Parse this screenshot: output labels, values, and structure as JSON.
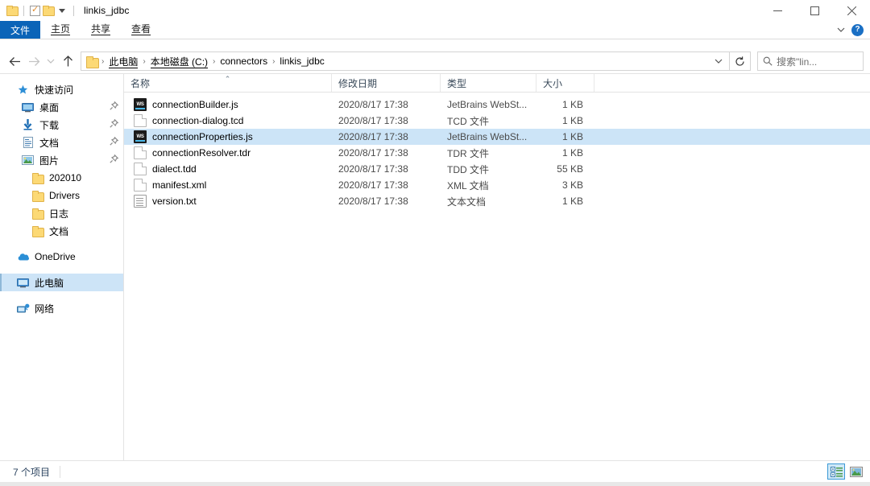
{
  "window": {
    "title": "linkis_jdbc",
    "quick_access": [
      {
        "name": "folder-icon",
        "label": "文件夹"
      },
      {
        "name": "properties-icon",
        "label": "属性"
      },
      {
        "name": "new-folder-icon",
        "label": "新建文件夹"
      },
      {
        "name": "customize-caret-icon",
        "label": "自定义快速访问工具栏"
      }
    ],
    "controls": {
      "minimize": "最小化",
      "maximize": "最大化",
      "close": "关闭"
    }
  },
  "ribbon": {
    "tabs": [
      {
        "label": "文件",
        "active": true
      },
      {
        "label": "主页",
        "active": false
      },
      {
        "label": "共享",
        "active": false
      },
      {
        "label": "查看",
        "active": false
      }
    ],
    "collapse_label": "折叠功能区",
    "help_label": "?"
  },
  "nav": {
    "back": "后退",
    "forward": "前进",
    "recent": "最近浏览的位置",
    "up": "上移一级",
    "dropdown": "以前的位置",
    "refresh": "刷新"
  },
  "breadcrumb": {
    "items": [
      "此电脑",
      "本地磁盘 (C:)",
      "connectors",
      "linkis_jdbc"
    ],
    "separator": "›"
  },
  "search": {
    "placeholder": "搜索\"lin...",
    "icon": "search-icon"
  },
  "sidebar": {
    "items": [
      {
        "label": "快速访问",
        "icon": "star-icon",
        "level": 0,
        "pinned": false,
        "selected": false
      },
      {
        "label": "桌面",
        "icon": "desktop-icon",
        "level": 1,
        "pinned": true,
        "selected": false
      },
      {
        "label": "下载",
        "icon": "download-icon",
        "level": 1,
        "pinned": true,
        "selected": false
      },
      {
        "label": "文档",
        "icon": "documents-icon",
        "level": 1,
        "pinned": true,
        "selected": false
      },
      {
        "label": "图片",
        "icon": "pictures-icon",
        "level": 1,
        "pinned": true,
        "selected": false
      },
      {
        "label": "202010",
        "icon": "folder-icon",
        "level": 2,
        "pinned": false,
        "selected": false
      },
      {
        "label": "Drivers",
        "icon": "folder-icon",
        "level": 2,
        "pinned": false,
        "selected": false
      },
      {
        "label": "日志",
        "icon": "folder-icon",
        "level": 2,
        "pinned": false,
        "selected": false
      },
      {
        "label": "文档",
        "icon": "folder-icon",
        "level": 2,
        "pinned": false,
        "selected": false
      },
      {
        "label": "OneDrive",
        "icon": "cloud-icon",
        "level": 0,
        "pinned": false,
        "selected": false
      },
      {
        "label": "此电脑",
        "icon": "computer-icon",
        "level": 0,
        "pinned": false,
        "selected": true
      },
      {
        "label": "网络",
        "icon": "network-icon",
        "level": 0,
        "pinned": false,
        "selected": false
      }
    ]
  },
  "filelist": {
    "columns": [
      {
        "label": "名称",
        "sorted": "asc"
      },
      {
        "label": "修改日期",
        "sorted": ""
      },
      {
        "label": "类型",
        "sorted": ""
      },
      {
        "label": "大小",
        "sorted": ""
      }
    ],
    "sort_caret": "⌃",
    "rows": [
      {
        "name": "connectionBuilder.js",
        "date": "2020/8/17 17:38",
        "type": "JetBrains WebSt...",
        "size": "1 KB",
        "icon": "webstorm-file-icon",
        "selected": false
      },
      {
        "name": "connection-dialog.tcd",
        "date": "2020/8/17 17:38",
        "type": "TCD 文件",
        "size": "1 KB",
        "icon": "generic-file-icon",
        "selected": false
      },
      {
        "name": "connectionProperties.js",
        "date": "2020/8/17 17:38",
        "type": "JetBrains WebSt...",
        "size": "1 KB",
        "icon": "webstorm-file-icon",
        "selected": true
      },
      {
        "name": "connectionResolver.tdr",
        "date": "2020/8/17 17:38",
        "type": "TDR 文件",
        "size": "1 KB",
        "icon": "generic-file-icon",
        "selected": false
      },
      {
        "name": "dialect.tdd",
        "date": "2020/8/17 17:38",
        "type": "TDD 文件",
        "size": "55 KB",
        "icon": "generic-file-icon",
        "selected": false
      },
      {
        "name": "manifest.xml",
        "date": "2020/8/17 17:38",
        "type": "XML 文档",
        "size": "3 KB",
        "icon": "generic-file-icon",
        "selected": false
      },
      {
        "name": "version.txt",
        "date": "2020/8/17 17:38",
        "type": "文本文档",
        "size": "1 KB",
        "icon": "text-file-icon",
        "selected": false
      }
    ]
  },
  "statusbar": {
    "item_count": "7 个项目",
    "views": [
      {
        "name": "details-view-button",
        "label": "详细信息",
        "active": true
      },
      {
        "name": "large-icons-view-button",
        "label": "大图标",
        "active": false
      }
    ]
  },
  "colors": {
    "accent": "#0b64b8",
    "selection": "#cce4f7",
    "nav_selection": "#cde4f7",
    "folder": "#fcd975",
    "help_blue": "#1a6fc4"
  }
}
